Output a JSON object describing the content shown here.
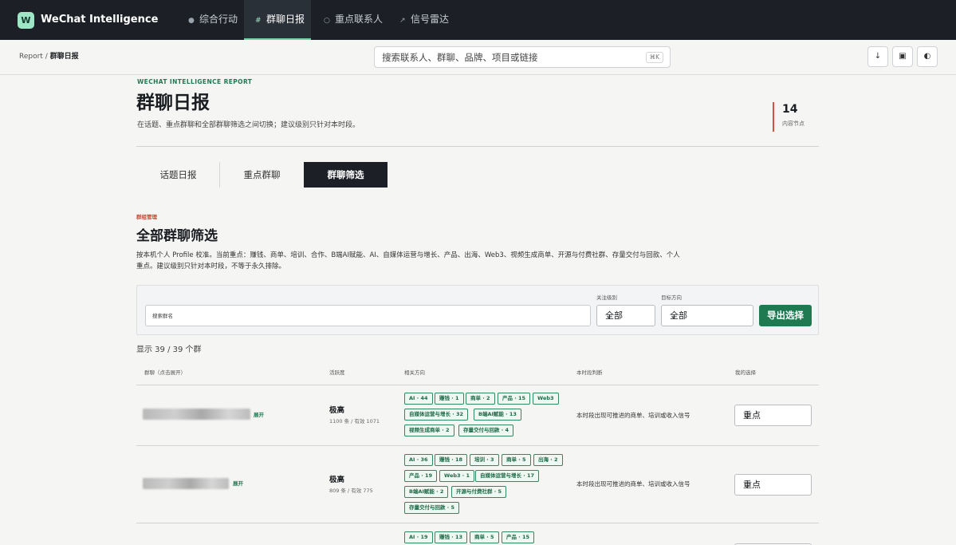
{
  "app": {
    "logo_letter": "W",
    "name": "WeChat Intelligence"
  },
  "nav": [
    {
      "icon": "●",
      "label": "综合行动",
      "active": false
    },
    {
      "icon": "#",
      "label": "群聊日报",
      "active": true
    },
    {
      "icon": "○",
      "label": "重点联系人",
      "active": false
    },
    {
      "icon": "↗",
      "label": "信号雷达",
      "active": false
    }
  ],
  "breadcrumb": {
    "root": "Report",
    "sep": " / ",
    "current": "群聊日报"
  },
  "search": {
    "placeholder": "搜索联系人、群聊、品牌、项目或链接",
    "shortcut": "⌘K"
  },
  "toolbar": {
    "download_icon": "↓",
    "stop_icon": "▣",
    "theme_icon": "◐"
  },
  "header": {
    "eyebrow": "WECHAT INTELLIGENCE REPORT",
    "title": "群聊日报",
    "subtitle": "在话题、重点群聊和全部群聊筛选之间切换；建议级别只针对本时段。",
    "stat_value": "14",
    "stat_label": "内容节点"
  },
  "view_tabs": [
    {
      "label": "话题日报",
      "active": false
    },
    {
      "label": "重点群聊",
      "active": false
    },
    {
      "label": "群聊筛选",
      "active": true
    }
  ],
  "section": {
    "eyebrow": "群组管理",
    "title": "全部群聊筛选",
    "description": "按本机个人 Profile 校准。当前重点：赚钱、商单、培训、合作、B端AI赋能、AI、自媒体运营与增长、产品、出海、Web3、视频生成商单、开源与付费社群、存量交付与回款、个人重点。建议级别只针对本时段，不等于永久排除。"
  },
  "filters": {
    "group_placeholder": "搜索群名",
    "level_label": "关注级别",
    "level_value": "全部",
    "direction_label": "目标方向",
    "direction_value": "全部",
    "export_label": "导出选择"
  },
  "count_text": "显示 39 / 39 个群",
  "table": {
    "headers": {
      "group": "群聊（点击展开）",
      "activity": "活跃度",
      "directions": "相关方向",
      "judgement": "本时段判断",
      "choice": "我的选择"
    },
    "rows": [
      {
        "expand_label": "展开",
        "activity": "极高",
        "activity_detail": "1100 条 / 有效 1071",
        "tags": [
          "AI · 44",
          "赚钱 · 1",
          "商单 · 2",
          "产品 · 15",
          "Web3",
          "自媒体运营与增长 · 32",
          "B端AI赋能 · 13",
          "视频生成商单 · 2",
          "存量交付与回款 · 4"
        ],
        "judgement": "本时段出现可推进的商单、培训或收入信号",
        "choice": "重点"
      },
      {
        "expand_label": "展开",
        "activity": "极高",
        "activity_detail": "809 条 / 有效 775",
        "tags": [
          "AI · 36",
          "赚钱 · 18",
          "培训 · 3",
          "商单 · 5",
          "出海 · 2",
          "产品 · 19",
          "Web3 · 1",
          "自媒体运营与增长 · 17",
          "B端AI赋能 · 2",
          "开源与付费社群 · 5",
          "存量交付与回款 · 5"
        ],
        "judgement": "本时段出现可推进的商单、培训或收入信号",
        "choice": "重点"
      },
      {
        "tags": [
          "AI · 19",
          "赚钱 · 13",
          "商单 · 5",
          "产品 · 15"
        ]
      }
    ]
  }
}
